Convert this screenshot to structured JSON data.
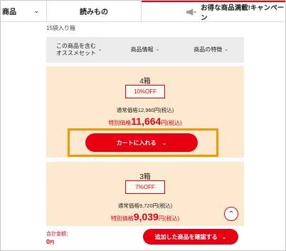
{
  "nav": {
    "item1": "商品",
    "item2": "読みもの",
    "item3": "お得な商品満載!キャンペーン",
    "megaphone_icon": "megaphone-icon"
  },
  "subtitle": "15袋入り箱",
  "tabs": [
    {
      "label_line1": "この商品を含む",
      "label_line2": "オススメセット"
    },
    {
      "label_line1": "商品情報",
      "label_line2": ""
    },
    {
      "label_line1": "商品の特徴",
      "label_line2": ""
    }
  ],
  "products": [
    {
      "qty": "4箱",
      "discount": "10%OFF",
      "regular": "通常価格12,960円(税込)",
      "special_prefix": "特別価格",
      "special_price": "11,664",
      "special_suffix": "円(税込)"
    },
    {
      "qty": "3箱",
      "discount": "7%OFF",
      "regular": "通常価格9,720円(税込)",
      "special_prefix": "特別価格",
      "special_price": "9,039",
      "special_suffix": "円(税込)"
    }
  ],
  "cart_button": "カートに入れる",
  "footer": {
    "total_label": "合計金額：",
    "total_value": "0",
    "total_unit": "円",
    "confirm_button": "追加した商品を確認する"
  },
  "colors": {
    "accent": "#e60012",
    "highlight": "#f39800",
    "panel": "#fce9cf"
  }
}
